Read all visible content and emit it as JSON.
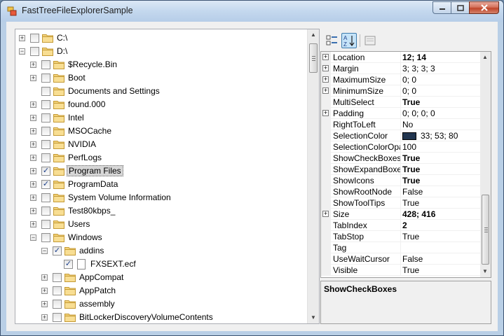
{
  "window": {
    "title": "FastTreeFileExplorerSample"
  },
  "tree": {
    "nodes": [
      {
        "label": "C:\\",
        "level": 0,
        "expander": "+",
        "checked": false,
        "kind": "folder"
      },
      {
        "label": "D:\\",
        "level": 0,
        "expander": "-",
        "checked": false,
        "kind": "folder"
      },
      {
        "label": "$Recycle.Bin",
        "level": 1,
        "expander": "+",
        "checked": false,
        "kind": "folder"
      },
      {
        "label": "Boot",
        "level": 1,
        "expander": "+",
        "checked": false,
        "kind": "folder"
      },
      {
        "label": "Documents and Settings",
        "level": 1,
        "expander": "",
        "checked": false,
        "kind": "folder"
      },
      {
        "label": "found.000",
        "level": 1,
        "expander": "+",
        "checked": false,
        "kind": "folder"
      },
      {
        "label": "Intel",
        "level": 1,
        "expander": "+",
        "checked": false,
        "kind": "folder"
      },
      {
        "label": "MSOCache",
        "level": 1,
        "expander": "+",
        "checked": false,
        "kind": "folder"
      },
      {
        "label": "NVIDIA",
        "level": 1,
        "expander": "+",
        "checked": false,
        "kind": "folder"
      },
      {
        "label": "PerfLogs",
        "level": 1,
        "expander": "+",
        "checked": false,
        "kind": "folder"
      },
      {
        "label": "Program Files",
        "level": 1,
        "expander": "+",
        "checked": true,
        "kind": "folder",
        "selected": true
      },
      {
        "label": "ProgramData",
        "level": 1,
        "expander": "+",
        "checked": true,
        "kind": "folder"
      },
      {
        "label": "System Volume Information",
        "level": 1,
        "expander": "+",
        "checked": false,
        "kind": "folder"
      },
      {
        "label": "Test80kbps_",
        "level": 1,
        "expander": "+",
        "checked": false,
        "kind": "folder"
      },
      {
        "label": "Users",
        "level": 1,
        "expander": "+",
        "checked": false,
        "kind": "folder"
      },
      {
        "label": "Windows",
        "level": 1,
        "expander": "-",
        "checked": false,
        "kind": "folder"
      },
      {
        "label": "addins",
        "level": 2,
        "expander": "-",
        "checked": true,
        "kind": "folder"
      },
      {
        "label": "FXSEXT.ecf",
        "level": 3,
        "expander": "",
        "checked": true,
        "kind": "file"
      },
      {
        "label": "AppCompat",
        "level": 2,
        "expander": "+",
        "checked": false,
        "kind": "folder"
      },
      {
        "label": "AppPatch",
        "level": 2,
        "expander": "+",
        "checked": false,
        "kind": "folder"
      },
      {
        "label": "assembly",
        "level": 2,
        "expander": "+",
        "checked": false,
        "kind": "folder"
      },
      {
        "label": "BitLockerDiscoveryVolumeContents",
        "level": 2,
        "expander": "+",
        "checked": false,
        "kind": "folder"
      }
    ]
  },
  "properties": {
    "rows": [
      {
        "name": "Location",
        "value": "12; 14",
        "bold": true,
        "expandable": true
      },
      {
        "name": "Margin",
        "value": "3; 3; 3; 3",
        "bold": false,
        "expandable": true
      },
      {
        "name": "MaximumSize",
        "value": "0; 0",
        "bold": false,
        "expandable": true
      },
      {
        "name": "MinimumSize",
        "value": "0; 0",
        "bold": false,
        "expandable": true
      },
      {
        "name": "MultiSelect",
        "value": "True",
        "bold": true,
        "expandable": false
      },
      {
        "name": "Padding",
        "value": "0; 0; 0; 0",
        "bold": false,
        "expandable": true
      },
      {
        "name": "RightToLeft",
        "value": "No",
        "bold": false,
        "expandable": false
      },
      {
        "name": "SelectionColor",
        "value": "33; 53; 80",
        "bold": false,
        "expandable": false,
        "swatch": "#21354f"
      },
      {
        "name": "SelectionColorOpaq",
        "value": "100",
        "bold": false,
        "expandable": false
      },
      {
        "name": "ShowCheckBoxes",
        "value": "True",
        "bold": true,
        "expandable": false
      },
      {
        "name": "ShowExpandBoxes",
        "value": "True",
        "bold": true,
        "expandable": false
      },
      {
        "name": "ShowIcons",
        "value": "True",
        "bold": true,
        "expandable": false
      },
      {
        "name": "ShowRootNode",
        "value": "False",
        "bold": false,
        "expandable": false
      },
      {
        "name": "ShowToolTips",
        "value": "True",
        "bold": false,
        "expandable": false
      },
      {
        "name": "Size",
        "value": "428; 416",
        "bold": true,
        "expandable": true
      },
      {
        "name": "TabIndex",
        "value": "2",
        "bold": true,
        "expandable": false
      },
      {
        "name": "TabStop",
        "value": "True",
        "bold": false,
        "expandable": false
      },
      {
        "name": "Tag",
        "value": "",
        "bold": false,
        "expandable": false
      },
      {
        "name": "UseWaitCursor",
        "value": "False",
        "bold": false,
        "expandable": false
      },
      {
        "name": "Visible",
        "value": "True",
        "bold": false,
        "expandable": false
      }
    ]
  },
  "help": {
    "title": "ShowCheckBoxes"
  },
  "colors": {
    "selection": "#21354f",
    "folder": "#f3d27a"
  }
}
